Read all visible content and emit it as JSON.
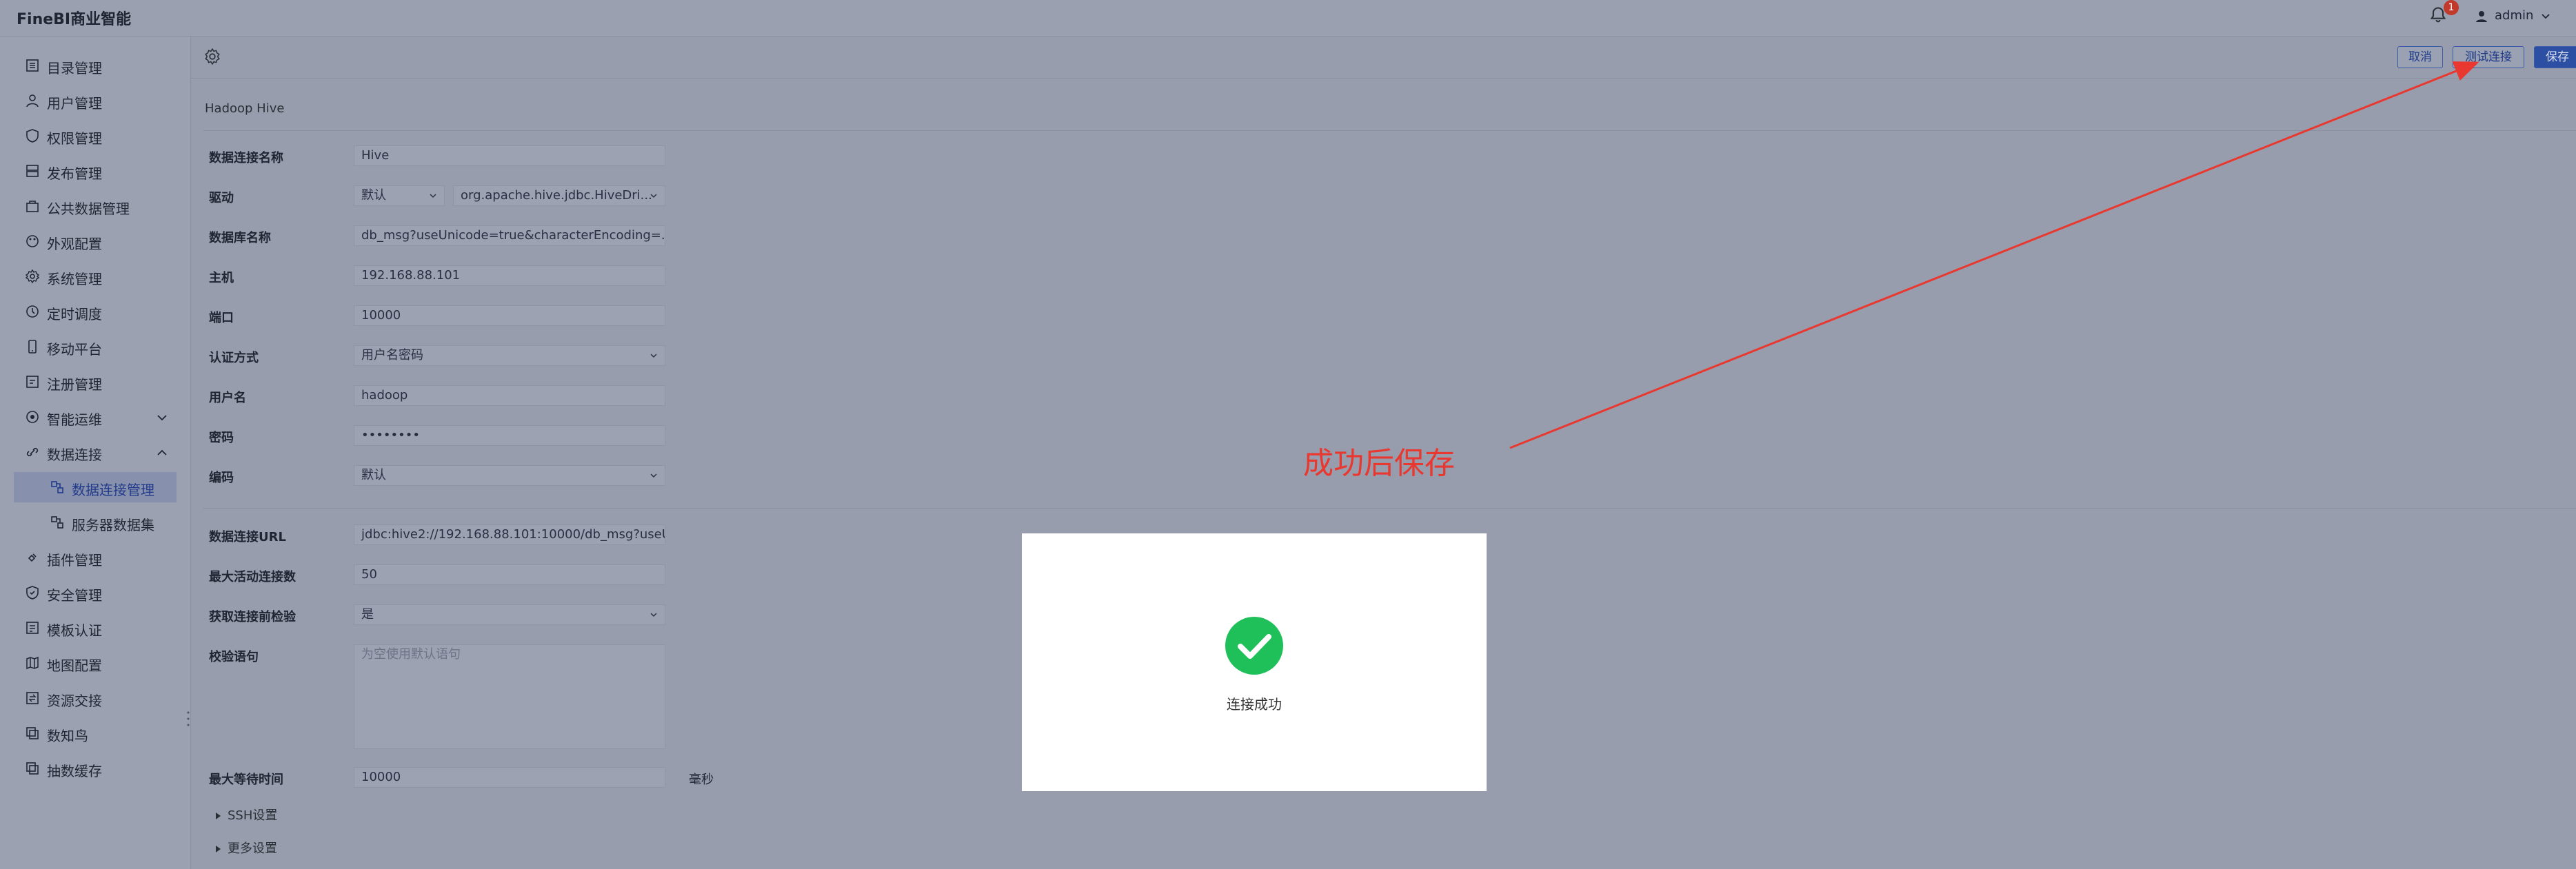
{
  "app": {
    "title": "FineBI商业智能"
  },
  "header": {
    "notification_count": "1",
    "user": "admin"
  },
  "sidebar": {
    "items": [
      {
        "label": "目录管理",
        "icon": "list-icon"
      },
      {
        "label": "用户管理",
        "icon": "user-icon"
      },
      {
        "label": "权限管理",
        "icon": "shield-icon"
      },
      {
        "label": "发布管理",
        "icon": "publish-icon"
      },
      {
        "label": "公共数据管理",
        "icon": "database-icon"
      },
      {
        "label": "外观配置",
        "icon": "palette-icon"
      },
      {
        "label": "系统管理",
        "icon": "gear-icon"
      },
      {
        "label": "定时调度",
        "icon": "clock-icon"
      },
      {
        "label": "移动平台",
        "icon": "mobile-icon"
      },
      {
        "label": "注册管理",
        "icon": "register-icon"
      },
      {
        "label": "智能运维",
        "icon": "ops-icon"
      },
      {
        "label": "数据连接",
        "icon": "link-icon"
      },
      {
        "label": "数据连接管理",
        "icon": "connection-icon"
      },
      {
        "label": "服务器数据集",
        "icon": "server-icon"
      },
      {
        "label": "插件管理",
        "icon": "plugin-icon"
      },
      {
        "label": "安全管理",
        "icon": "security-icon"
      },
      {
        "label": "模板认证",
        "icon": "certificate-icon"
      },
      {
        "label": "地图配置",
        "icon": "map-icon"
      },
      {
        "label": "资源交接",
        "icon": "transfer-icon"
      },
      {
        "label": "数知鸟",
        "icon": "bird-icon"
      },
      {
        "label": "抽数缓存",
        "icon": "cache-icon"
      }
    ]
  },
  "toolbar": {
    "cancel_label": "取消",
    "test_label": "测试连接",
    "save_label": "保存"
  },
  "form": {
    "section_title": "Hadoop Hive",
    "conn_name_label": "数据连接名称",
    "conn_name_value": "Hive",
    "driver_label": "驱动",
    "driver_mode": "默认",
    "driver_class": "org.apache.hive.jdbc.HiveDri...",
    "db_name_label": "数据库名称",
    "db_name_value": "db_msg?useUnicode=true&characterEncoding=...",
    "host_label": "主机",
    "host_value": "192.168.88.101",
    "port_label": "端口",
    "port_value": "10000",
    "auth_label": "认证方式",
    "auth_value": "用户名密码",
    "username_label": "用户名",
    "username_value": "hadoop",
    "password_label": "密码",
    "password_value": "••••••••",
    "encoding_label": "编码",
    "encoding_value": "默认",
    "url_label": "数据连接URL",
    "url_value": "jdbc:hive2://192.168.88.101:10000/db_msg?useU...",
    "max_active_label": "最大活动连接数",
    "max_active_value": "50",
    "validate_label": "获取连接前检验",
    "validate_value": "是",
    "query_label": "校验语句",
    "query_placeholder": "为空使用默认语句",
    "max_wait_label": "最大等待时间",
    "max_wait_value": "10000",
    "max_wait_unit": "毫秒",
    "ssh_label": "SSH设置",
    "more_label": "更多设置"
  },
  "annotation": {
    "text": "成功后保存",
    "color": "#e8382f"
  },
  "modal": {
    "message": "连接成功",
    "success_color": "#1fbf5a"
  }
}
